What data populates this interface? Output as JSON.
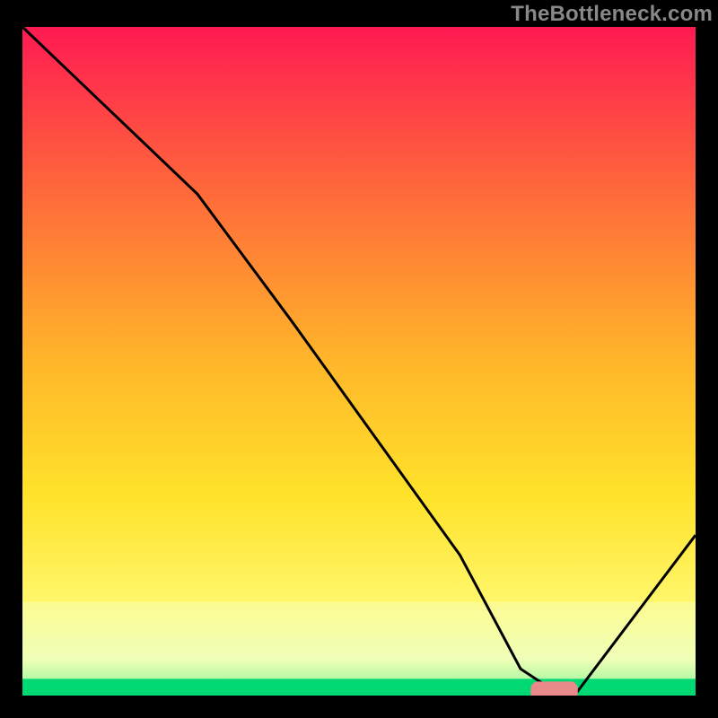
{
  "watermark": "TheBottleneck.com",
  "chart_data": {
    "type": "line",
    "title": "",
    "xlabel": "",
    "ylabel": "",
    "xlim": [
      0,
      100
    ],
    "ylim": [
      0,
      100
    ],
    "gradient_colors_top_to_bottom": [
      "#ff1a52",
      "#ff6a3a",
      "#ffb62a",
      "#ffe22a",
      "#fff66a",
      "#e6ffc0",
      "#00e673"
    ],
    "series": [
      {
        "name": "bottleneck-curve",
        "x": [
          0,
          26,
          40,
          50,
          65,
          74,
          80,
          82,
          100
        ],
        "y": [
          100,
          75,
          56,
          42,
          21,
          4,
          0,
          0,
          24
        ]
      }
    ],
    "marker": {
      "name": "optimal-zone",
      "x_center": 79,
      "y": 0.7,
      "width": 7,
      "color": "#e98a8a"
    }
  }
}
